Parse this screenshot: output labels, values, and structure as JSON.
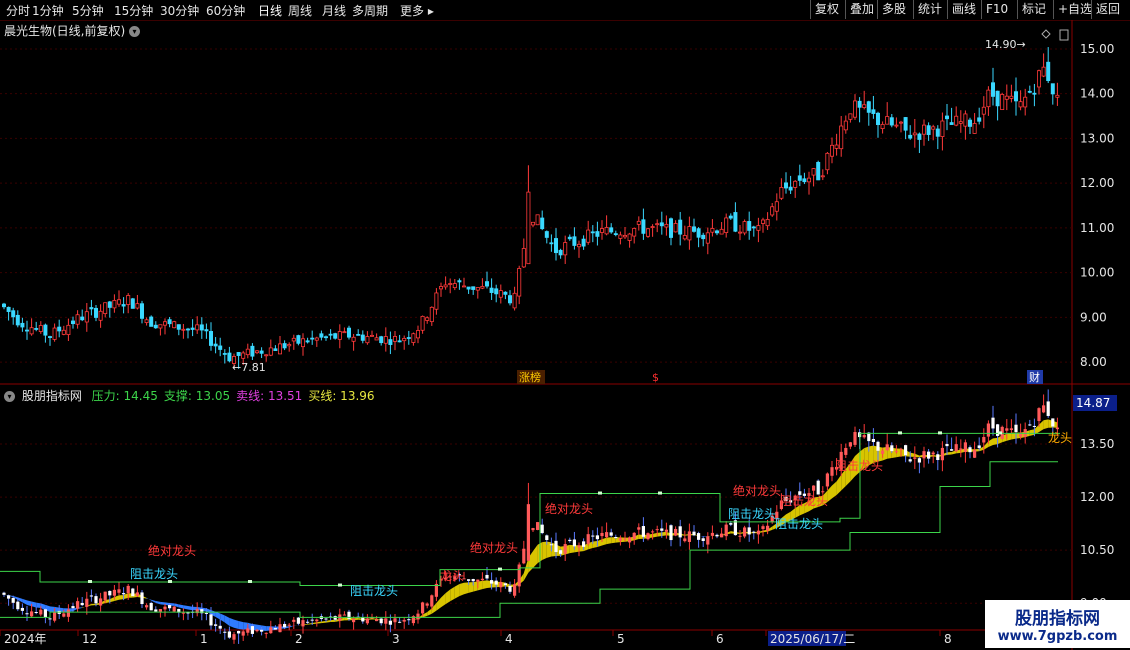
{
  "toolbar": {
    "periods": [
      "分时",
      "1分钟",
      "5分钟",
      "15分钟",
      "30分钟",
      "60分钟",
      "日线",
      "周线",
      "月线",
      "多周期",
      "更多"
    ],
    "active": "日线",
    "right": [
      "复权",
      "叠加",
      "多股",
      "统计",
      "画线",
      "F10",
      "标记",
      "+自选",
      "返回"
    ]
  },
  "upper": {
    "title": "晨光生物(日线,前复权)",
    "y_ticks": [
      "15.00",
      "14.00",
      "13.00",
      "12.00",
      "11.00",
      "10.00",
      "9.00",
      "8.00"
    ],
    "high_label": "14.90",
    "low_label": "7.81",
    "markers": [
      "涨榜",
      "$",
      "财"
    ]
  },
  "lower": {
    "name": "股朋指标网",
    "legend": [
      {
        "key": "压力",
        "value": "14.45",
        "color": "#3cd44a"
      },
      {
        "key": "支撑",
        "value": "13.05",
        "color": "#3cd44a"
      },
      {
        "key": "卖线",
        "value": "13.51",
        "color": "#e040e0"
      },
      {
        "key": "买线",
        "value": "13.96",
        "color": "#e8e840"
      }
    ],
    "y_ticks": [
      "13.50",
      "12.00",
      "10.50",
      "9.00"
    ],
    "current_value": "14.87",
    "labels": [
      "绝对龙头",
      "阻击龙头",
      "阻击龙头",
      "绝对龙头",
      "绝对龙头",
      "龙头",
      "阻击龙头",
      "阻击龙头",
      "绝对龙头",
      "阻击龙头",
      "阻击龙头",
      "龙头"
    ]
  },
  "x_axis": {
    "labels": [
      "2024年",
      "12",
      "1",
      "2",
      "3",
      "4",
      "5",
      "6",
      "2025/06/17/二",
      "8"
    ]
  },
  "watermark": {
    "line1": "股朋指标网",
    "line2": "www.7gpzb.com"
  },
  "chart_data": {
    "type": "line",
    "title": "晨光生物(日线,前复权)",
    "ylim": [
      7.6,
      15.2
    ],
    "x": [
      "2024-11",
      "2024-12",
      "2025-01",
      "2025-02",
      "2025-03",
      "2025-04",
      "2025-05",
      "2025-06",
      "2025-07",
      "2025-08"
    ],
    "series": [
      {
        "name": "",
        "values": [
          9.1,
          8.9,
          8.1,
          8.4,
          8.8,
          10.2,
          10.8,
          11.0,
          12.3,
          13.9
        ]
      }
    ],
    "annotations": {
      "high": 14.9,
      "low": 7.81
    }
  }
}
